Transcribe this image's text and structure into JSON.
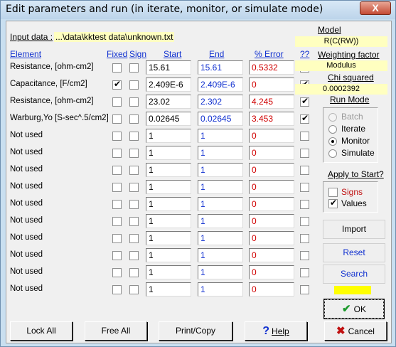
{
  "window": {
    "title": "Edit parameters and run (in iterate, monitor, or simulate mode)",
    "close_label": "X"
  },
  "input": {
    "label": "Input data :",
    "path": "...\\data\\kktest data\\unknown.txt"
  },
  "headers": {
    "element": "Element",
    "fixed": "Fixed",
    "sign": "Sign",
    "start": "Start",
    "end": "End",
    "error": "% Error",
    "qq": "??"
  },
  "rows": [
    {
      "element": "Resistance,    [ohm-cm2]",
      "fixed": false,
      "sign": false,
      "start": "15.61",
      "end": "15.61",
      "error": "0.5332",
      "qq": true
    },
    {
      "element": "Capacitance,    [F/cm2]",
      "fixed": true,
      "sign": false,
      "start": "2.409E-6",
      "end": "2.409E-6",
      "error": "0",
      "qq": true
    },
    {
      "element": "Resistance,    [ohm-cm2]",
      "fixed": false,
      "sign": false,
      "start": "23.02",
      "end": "2.302",
      "error": "4.245",
      "qq": true
    },
    {
      "element": "Warburg,Yo [S-sec^.5/cm2]",
      "fixed": false,
      "sign": false,
      "start": "0.02645",
      "end": "0.02645",
      "error": "3.453",
      "qq": true
    },
    {
      "element": "Not used",
      "fixed": false,
      "sign": false,
      "start": "1",
      "end": "1",
      "error": "0",
      "qq": false
    },
    {
      "element": "Not used",
      "fixed": false,
      "sign": false,
      "start": "1",
      "end": "1",
      "error": "0",
      "qq": false
    },
    {
      "element": "Not used",
      "fixed": false,
      "sign": false,
      "start": "1",
      "end": "1",
      "error": "0",
      "qq": false
    },
    {
      "element": "Not used",
      "fixed": false,
      "sign": false,
      "start": "1",
      "end": "1",
      "error": "0",
      "qq": false
    },
    {
      "element": "Not used",
      "fixed": false,
      "sign": false,
      "start": "1",
      "end": "1",
      "error": "0",
      "qq": false
    },
    {
      "element": "Not used",
      "fixed": false,
      "sign": false,
      "start": "1",
      "end": "1",
      "error": "0",
      "qq": false
    },
    {
      "element": "Not used",
      "fixed": false,
      "sign": false,
      "start": "1",
      "end": "1",
      "error": "0",
      "qq": false
    },
    {
      "element": "Not used",
      "fixed": false,
      "sign": false,
      "start": "1",
      "end": "1",
      "error": "0",
      "qq": false
    },
    {
      "element": "Not used",
      "fixed": false,
      "sign": false,
      "start": "1",
      "end": "1",
      "error": "0",
      "qq": false
    },
    {
      "element": "Not used",
      "fixed": false,
      "sign": false,
      "start": "1",
      "end": "1",
      "error": "0",
      "qq": false
    }
  ],
  "side": {
    "model_label": "Model",
    "model_value": "R(C(RW))",
    "weighting_label": "Weighting  factor",
    "weighting_value": "Modulus",
    "chi_label": "Chi squared",
    "chi_value": "0.0002392",
    "run_mode_label": "Run Mode",
    "run_modes": [
      {
        "label": "Batch",
        "selected": false,
        "disabled": true
      },
      {
        "label": "Iterate",
        "selected": false,
        "disabled": false
      },
      {
        "label": "Monitor",
        "selected": true,
        "disabled": false
      },
      {
        "label": "Simulate",
        "selected": false,
        "disabled": false
      }
    ],
    "apply_label": "Apply to Start?",
    "apply_signs": "Signs",
    "apply_signs_checked": false,
    "apply_values": "Values",
    "apply_values_checked": true,
    "import_label": "Import",
    "reset_label": "Reset",
    "search_label": "Search",
    "indicator_color": "#ffff00"
  },
  "buttons": {
    "lock_all": "Lock All",
    "free_all": "Free All",
    "print_copy": "Print/Copy",
    "help": "Help",
    "ok": "OK",
    "cancel": "Cancel"
  },
  "colors": {
    "end_text": "#1030d0",
    "error_text": "#d00000",
    "path_bg": "#ffffc0"
  }
}
